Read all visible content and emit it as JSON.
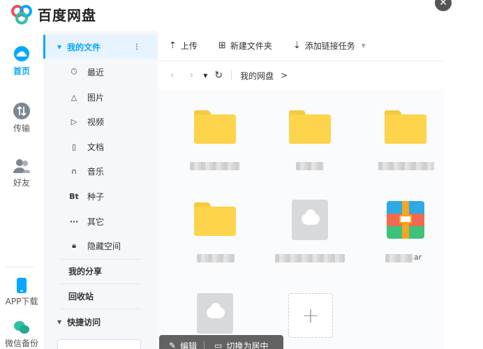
{
  "app": {
    "title": "百度网盘",
    "close_icon": "close-icon",
    "brand_color": "#06a7ff"
  },
  "rail": {
    "items": [
      {
        "label": "首页",
        "icon": "cloud-icon",
        "active": true
      },
      {
        "label": "传输",
        "icon": "transfer-icon"
      },
      {
        "label": "好友",
        "icon": "friends-icon"
      },
      {
        "label": "APP下载",
        "icon": "phone-icon"
      },
      {
        "label": "微信备份",
        "icon": "wechat-icon"
      }
    ]
  },
  "sidebar": {
    "my_files": "我的文件",
    "categories": [
      {
        "label": "最近",
        "icon": "clock-icon"
      },
      {
        "label": "图片",
        "icon": "image-icon"
      },
      {
        "label": "视频",
        "icon": "play-icon"
      },
      {
        "label": "文档",
        "icon": "document-icon"
      },
      {
        "label": "音乐",
        "icon": "headphones-icon"
      },
      {
        "label": "种子",
        "icon": "bt-icon"
      },
      {
        "label": "其它",
        "icon": "more-icon"
      },
      {
        "label": "隐藏空间",
        "icon": "lock-icon"
      }
    ],
    "my_share": "我的分享",
    "recycle": "回收站",
    "quick_access": "快捷访问",
    "bt_glyph": "Bt",
    "more_glyph": "···"
  },
  "toolbar": {
    "upload": "上传",
    "new_folder": "新建文件夹",
    "add_link_task": "添加链接任务"
  },
  "nav": {
    "breadcrumb": "我的网盘",
    "crumb_arrow": ">"
  },
  "files": [
    {
      "type": "folder"
    },
    {
      "type": "folder"
    },
    {
      "type": "folder"
    },
    {
      "type": "folder"
    },
    {
      "type": "file"
    },
    {
      "type": "rar",
      "name_suffix": "ar"
    },
    {
      "type": "file"
    }
  ],
  "new_button_glyph": "+",
  "floatbar": {
    "edit": "编辑",
    "switch_center": "切换为居中"
  }
}
